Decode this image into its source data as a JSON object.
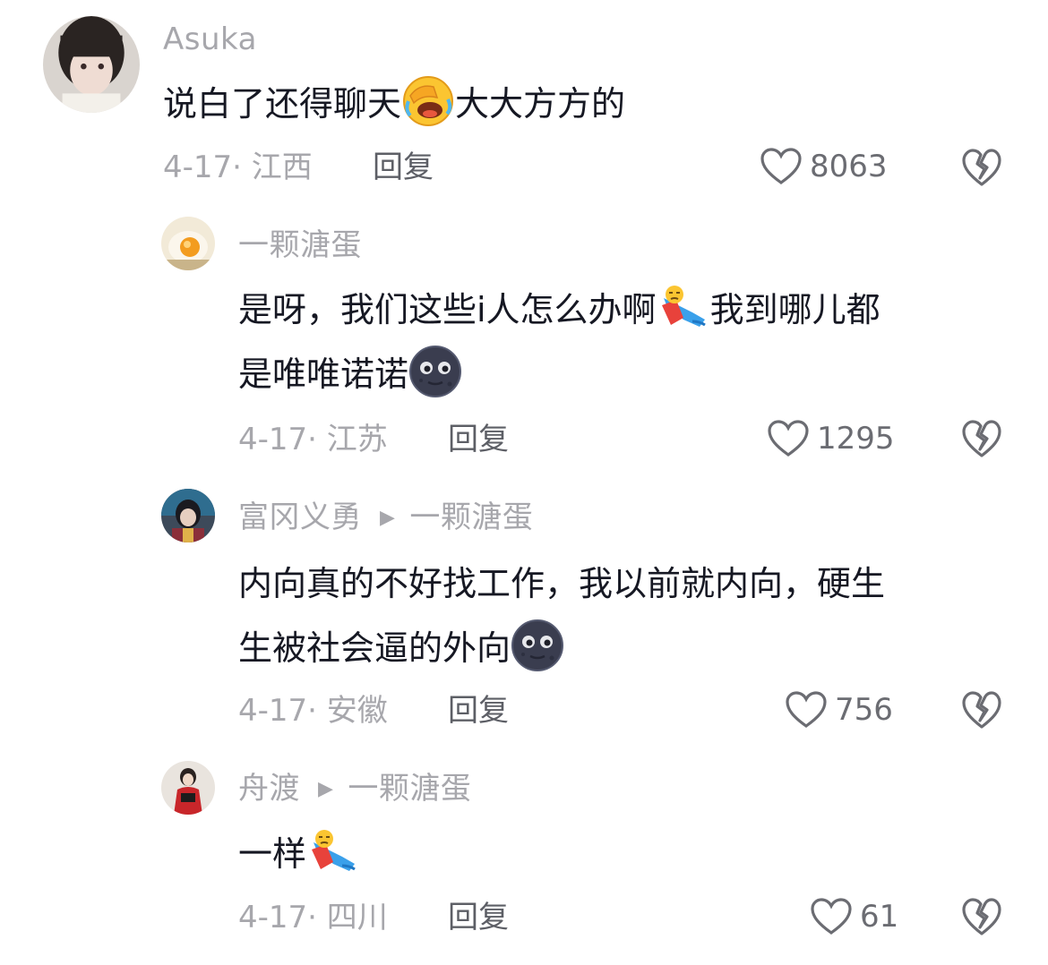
{
  "comments": [
    {
      "user": "Asuka",
      "reply_to": "",
      "text_lines": [
        [
          "说白了还得聊天",
          "emoji:facepalm-laugh",
          "大大方方的"
        ]
      ],
      "date": "4-17",
      "location": "江西",
      "reply_label": "回复",
      "likes": "8063"
    },
    {
      "user": "一颗溏蛋",
      "reply_to": "",
      "text_lines": [
        [
          "是呀，我们这些i人怎么办啊",
          "emoji:fallen-person",
          "我到哪儿都"
        ],
        [
          "是唯唯诺诺",
          "emoji:dark-moon-face"
        ]
      ],
      "date": "4-17",
      "location": "江苏",
      "reply_label": "回复",
      "likes": "1295"
    },
    {
      "user": "富冈义勇",
      "reply_to": "一颗溏蛋",
      "text_lines": [
        [
          "内向真的不好找工作，我以前就内向，硬生"
        ],
        [
          "生被社会逼的外向",
          "emoji:dark-moon-face"
        ]
      ],
      "date": "4-17",
      "location": "安徽",
      "reply_label": "回复",
      "likes": "756"
    },
    {
      "user": "舟渡",
      "reply_to": "一颗溏蛋",
      "text_lines": [
        [
          "一样",
          "emoji:fallen-person"
        ]
      ],
      "date": "4-17",
      "location": "四川",
      "reply_label": "回复",
      "likes": "61"
    }
  ],
  "colors": {
    "text": "#161823",
    "secondary": "#a7a7ac",
    "reply": "#5d5f66",
    "background": "#ffffff"
  }
}
